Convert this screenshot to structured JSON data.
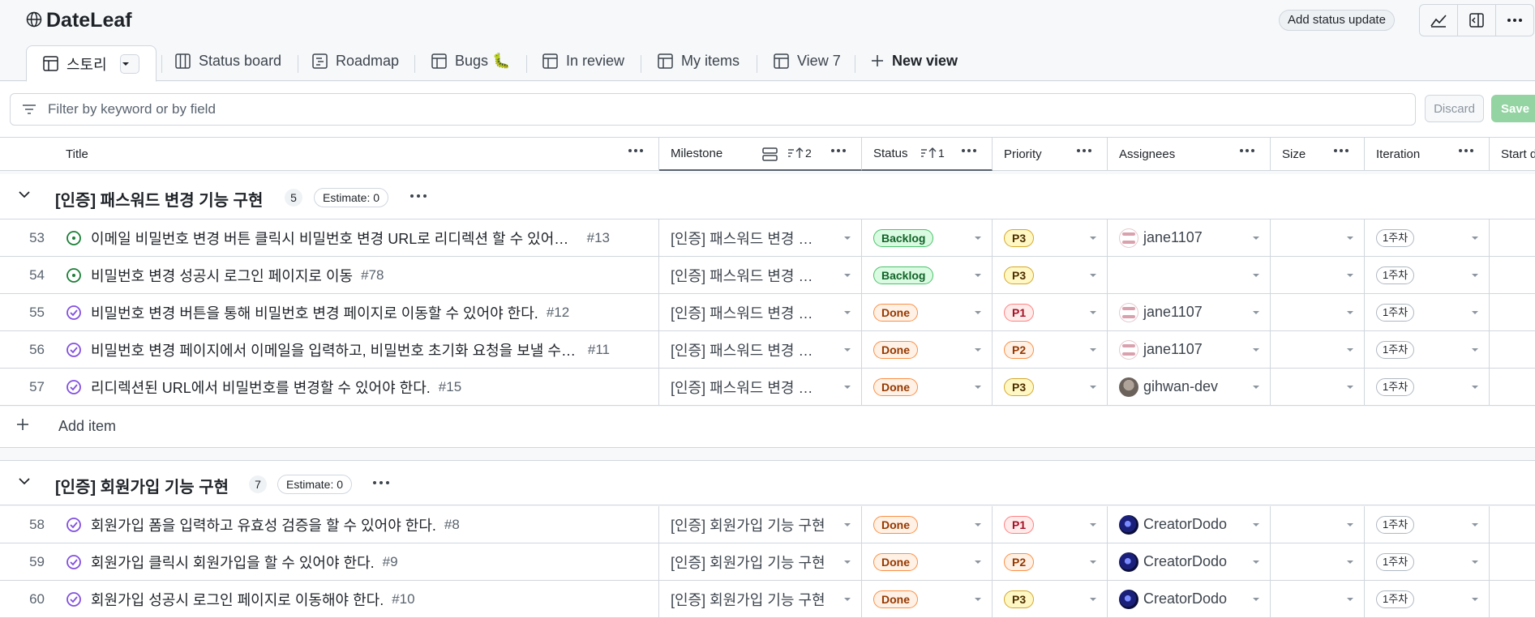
{
  "app": {
    "title": "DateLeaf",
    "status_update": "Add status update"
  },
  "tabs": [
    {
      "label": "스토리"
    },
    {
      "label": "Status board"
    },
    {
      "label": "Roadmap"
    },
    {
      "label": "Bugs 🐛"
    },
    {
      "label": "In review"
    },
    {
      "label": "My items"
    },
    {
      "label": "View 7"
    },
    {
      "label": "New view"
    }
  ],
  "filter": {
    "placeholder": "Filter by keyword or by field",
    "discard": "Discard",
    "save": "Save"
  },
  "columns": {
    "title": "Title",
    "milestone": "Milestone",
    "milestone_sort": "2",
    "status": "Status",
    "status_sort": "1",
    "priority": "Priority",
    "assignees": "Assignees",
    "size": "Size",
    "iteration": "Iteration",
    "start": "Start d"
  },
  "groups": [
    {
      "title": "[인증] 패스워드 변경 기능 구현",
      "count": "5",
      "estimate": "Estimate: 0",
      "rows": [
        {
          "n": "53",
          "state": "open",
          "title": "이메일 비밀번호 변경 버튼 클릭시 비밀번호 변경 URL로 리디렉션 할 수 있어야 한다.",
          "num": "#13",
          "milestone": "[인증] 패스워드 변경 기능 구현",
          "status": "Backlog",
          "priority": "P3",
          "assignee": "jane1107",
          "avatar": "jane",
          "iteration": "1주차"
        },
        {
          "n": "54",
          "state": "open",
          "title": "비밀번호 변경 성공시 로그인 페이지로 이동",
          "num": "#78",
          "milestone": "[인증] 패스워드 변경 기능 구현",
          "status": "Backlog",
          "priority": "P3",
          "assignee": "",
          "avatar": "",
          "iteration": "1주차"
        },
        {
          "n": "55",
          "state": "done",
          "title": "비밀번호 변경 버튼을 통해 비밀번호 변경 페이지로 이동할 수 있어야 한다.",
          "num": "#12",
          "milestone": "[인증] 패스워드 변경 기능 구현",
          "status": "Done",
          "priority": "P1",
          "assignee": "jane1107",
          "avatar": "jane",
          "iteration": "1주차"
        },
        {
          "n": "56",
          "state": "done",
          "title": "비밀번호 변경 페이지에서 이메일을 입력하고, 비밀번호 초기화 요청을 보낼 수 있어야 한다.",
          "num": "#11",
          "milestone": "[인증] 패스워드 변경 기능 구현",
          "status": "Done",
          "priority": "P2",
          "assignee": "jane1107",
          "avatar": "jane",
          "iteration": "1주차"
        },
        {
          "n": "57",
          "state": "done",
          "title": "리디렉션된 URL에서 비밀번호를 변경할 수 있어야 한다.",
          "num": "#15",
          "milestone": "[인증] 패스워드 변경 기능 구현",
          "status": "Done",
          "priority": "P3",
          "assignee": "gihwan-dev",
          "avatar": "gihwan",
          "iteration": "1주차"
        }
      ],
      "add_item": "Add item"
    },
    {
      "title": "[인증] 회원가입 기능 구현",
      "count": "7",
      "estimate": "Estimate: 0",
      "rows": [
        {
          "n": "58",
          "state": "done",
          "title": "회원가입 폼을 입력하고 유효성 검증을 할 수 있어야 한다.",
          "num": "#8",
          "milestone": "[인증] 회원가입 기능 구현",
          "status": "Done",
          "priority": "P1",
          "assignee": "CreatorDodo",
          "avatar": "creator",
          "iteration": "1주차"
        },
        {
          "n": "59",
          "state": "done",
          "title": "회원가입 클릭시 회원가입을 할 수 있어야 한다.",
          "num": "#9",
          "milestone": "[인증] 회원가입 기능 구현",
          "status": "Done",
          "priority": "P2",
          "assignee": "CreatorDodo",
          "avatar": "creator",
          "iteration": "1주차"
        },
        {
          "n": "60",
          "state": "done",
          "title": "회원가입 성공시 로그인 페이지로 이동해야 한다.",
          "num": "#10",
          "milestone": "[인증] 회원가입 기능 구현",
          "status": "Done",
          "priority": "P3",
          "assignee": "CreatorDodo",
          "avatar": "creator",
          "iteration": "1주차"
        }
      ]
    }
  ],
  "icons": [
    "globe-icon",
    "table-icon",
    "board-icon",
    "roadmap-icon",
    "plus-icon",
    "filter-icon",
    "kebab-icon",
    "chevron-down-icon",
    "issue-open-icon",
    "issue-closed-icon",
    "insights-icon",
    "panel-icon"
  ],
  "colors": {
    "open": "#1a7f37",
    "done": "#8250df",
    "save": "#94d3a2"
  }
}
